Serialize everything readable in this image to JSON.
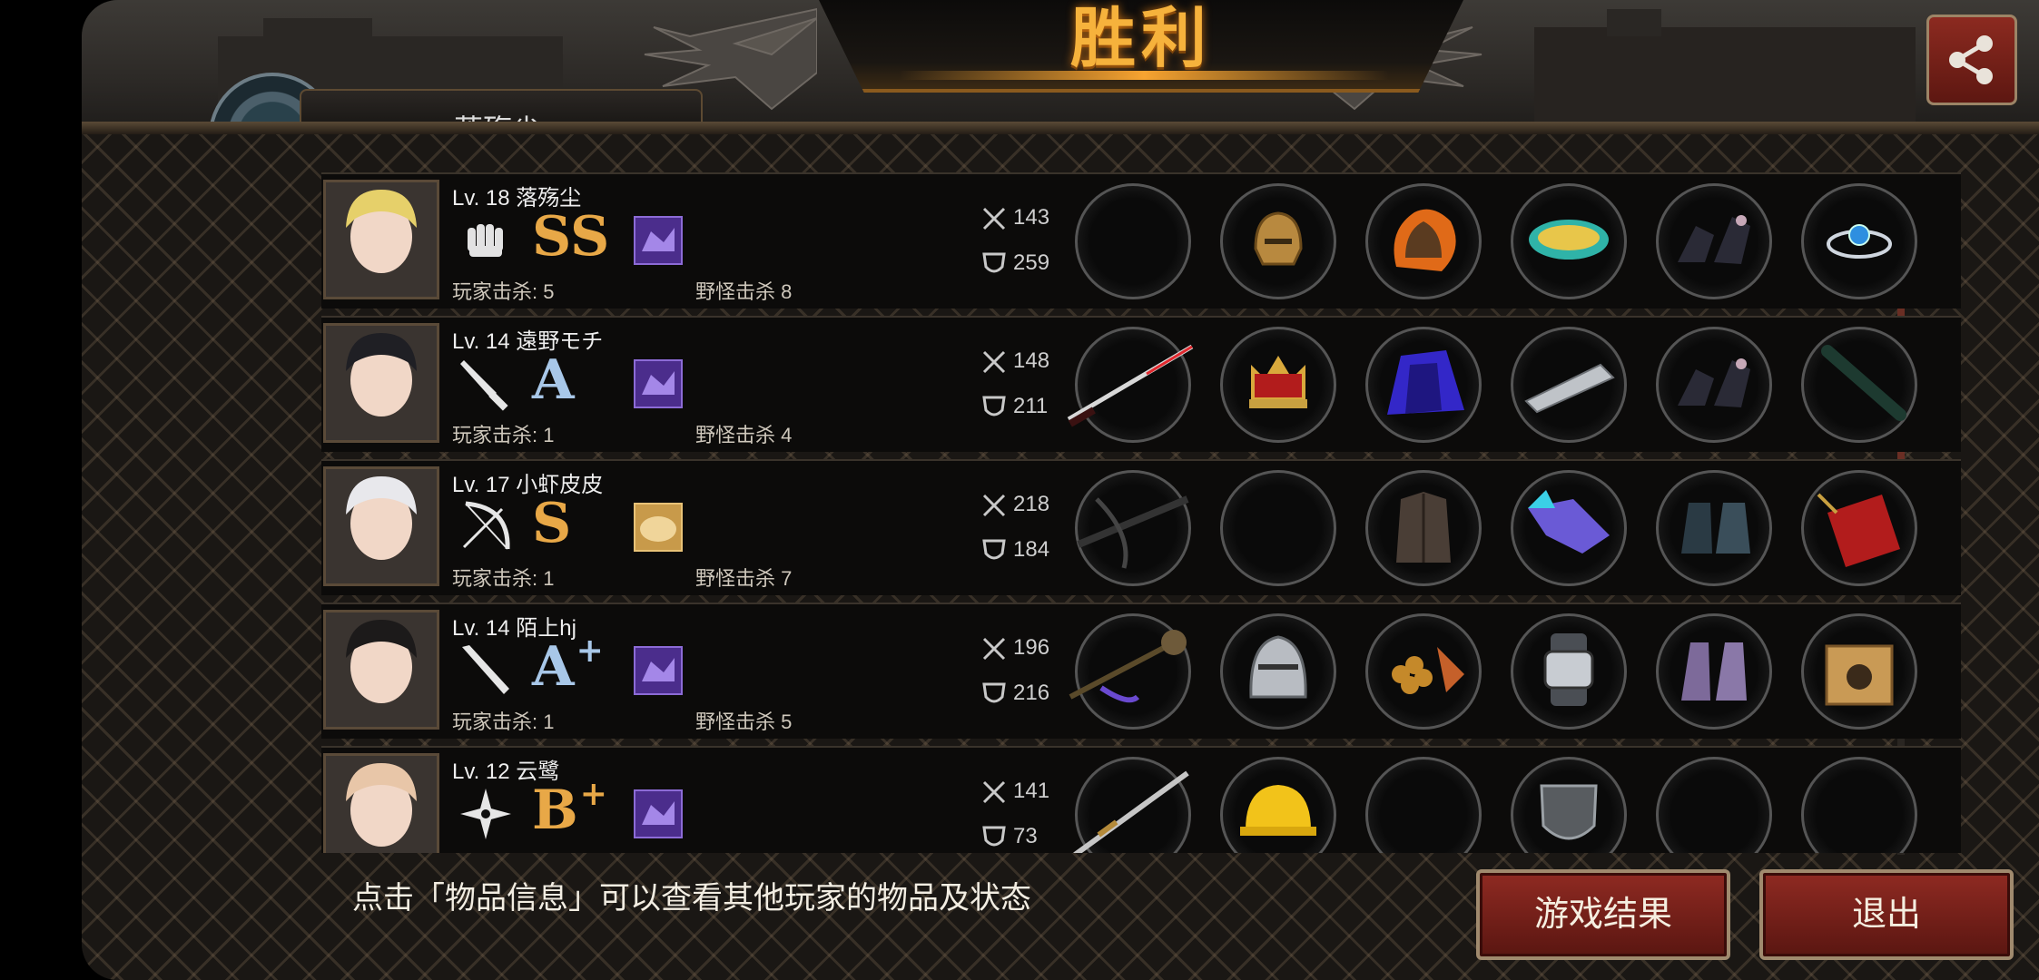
{
  "header": {
    "title": "胜利",
    "player_name_partial": "落殇尘",
    "share_icon": "share-icon"
  },
  "players": [
    {
      "level": "Lv. 18",
      "name": "落殇尘",
      "weapon_icon": "fist-icon",
      "grade": "SS",
      "grade_plus": "",
      "grade_color": "#e8a847",
      "item_icon": "purple-chip-icon",
      "player_kills": "玩家击杀: 5",
      "monster_kills": "野怪击杀 8",
      "attack": "143",
      "defense": "259",
      "slots": [
        "empty",
        "bronze-helmet-icon",
        "flaming-armor-icon",
        "gold-bracer-icon",
        "dark-boots-icon",
        "blue-gem-ring-icon"
      ]
    },
    {
      "level": "Lv. 14",
      "name": "遠野モチ",
      "weapon_icon": "knife-icon",
      "grade": "A",
      "grade_plus": "",
      "grade_color": "#a8c7e8",
      "item_icon": "purple-chip-icon",
      "player_kills": "玩家击杀: 1",
      "monster_kills": "野怪击杀 4",
      "attack": "148",
      "defense": "211",
      "slots": [
        "red-katana-icon",
        "royal-crown-icon",
        "blue-robe-icon",
        "spiked-gauntlet-icon",
        "dark-boots-icon",
        "baton-icon"
      ]
    },
    {
      "level": "Lv. 17",
      "name": "小虾皮皮",
      "weapon_icon": "bow-icon",
      "grade": "S",
      "grade_plus": "",
      "grade_color": "#e8a847",
      "item_icon": "bread-icon",
      "player_kills": "玩家击杀: 1",
      "monster_kills": "野怪击杀 7",
      "attack": "218",
      "defense": "184",
      "slots": [
        "crossbow-icon",
        "empty",
        "leather-jacket-icon",
        "crystal-claw-icon",
        "armored-boots-icon",
        "quiver-icon"
      ]
    },
    {
      "level": "Lv. 14",
      "name": "陌上hj",
      "weapon_icon": "bat-icon",
      "grade": "A",
      "grade_plus": "+",
      "grade_color": "#a8c7e8",
      "item_icon": "purple-chip-icon",
      "player_kills": "玩家击杀: 1",
      "monster_kills": "野怪击杀 5",
      "attack": "196",
      "defense": "216",
      "slots": [
        "spiked-flail-icon",
        "knight-helmet-icon",
        "grape-gauntlet-icon",
        "smart-watch-icon",
        "purple-boots-icon",
        "cat-box-icon"
      ]
    },
    {
      "level": "Lv. 12",
      "name": "云鹭",
      "weapon_icon": "shuriken-icon",
      "grade": "B",
      "grade_plus": "+",
      "grade_color": "#e8a847",
      "item_icon": "purple-chip-icon",
      "player_kills": "",
      "monster_kills": "",
      "attack": "141",
      "defense": "73",
      "slots": [
        "long-sword-icon",
        "hard-hat-icon",
        "empty",
        "iron-shield-icon",
        "empty",
        "empty"
      ]
    }
  ],
  "footer": {
    "hint": "点击「物品信息」可以查看其他玩家的物品及状态",
    "result_button": "游戏结果",
    "exit_button": "退出"
  }
}
